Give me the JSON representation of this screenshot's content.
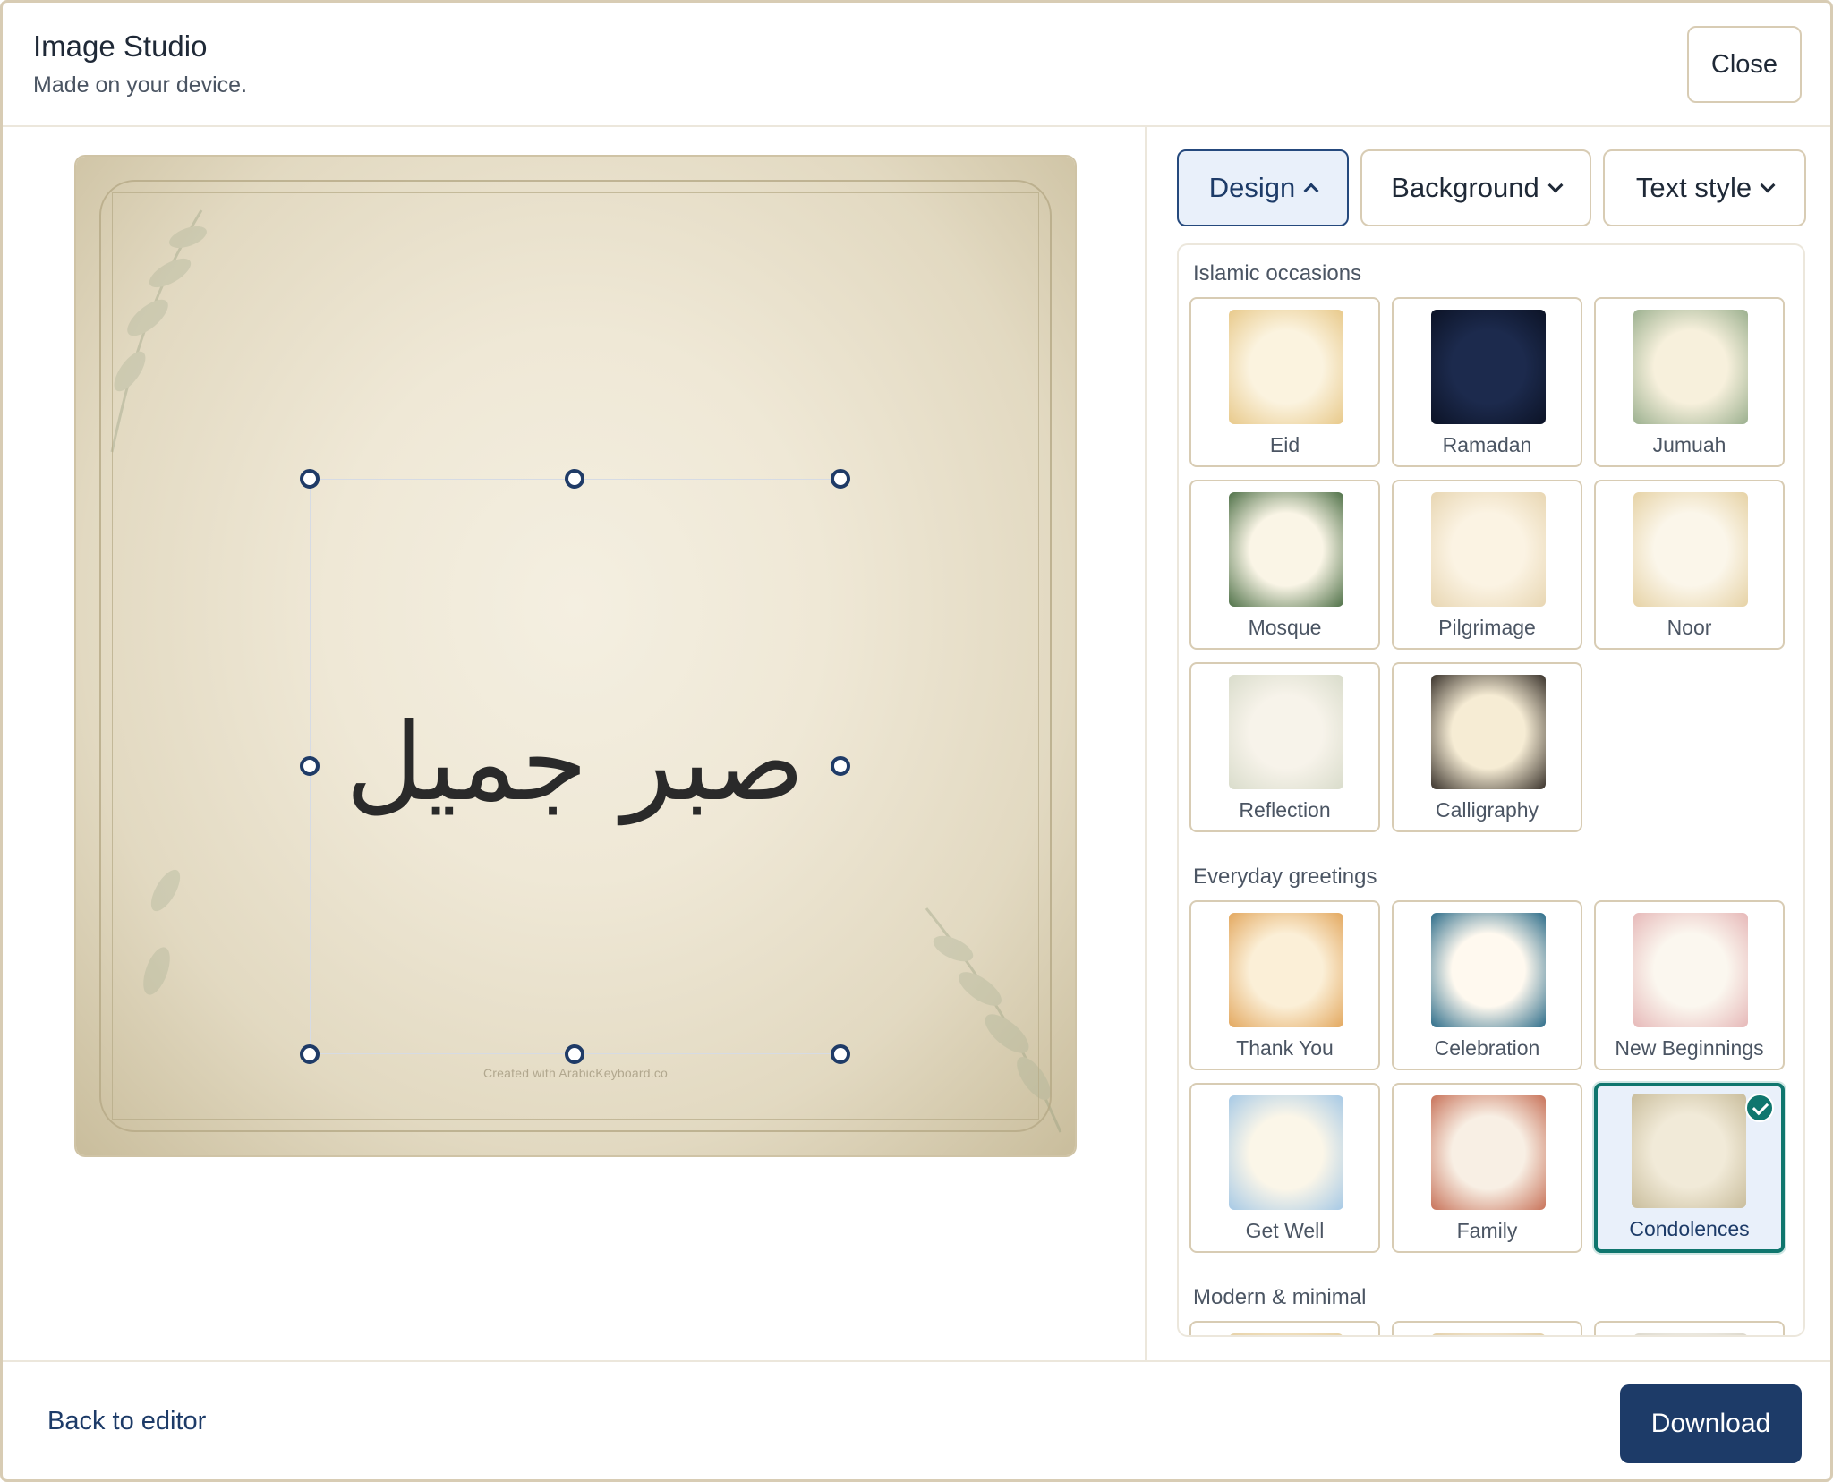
{
  "header": {
    "title": "Image Studio",
    "subtitle": "Made on your device.",
    "close_label": "Close"
  },
  "canvas": {
    "text": "صبر جميل",
    "watermark": "Created with ArabicKeyboard.co"
  },
  "tabs": [
    {
      "label": "Design",
      "active": true
    },
    {
      "label": "Background",
      "active": false
    },
    {
      "label": "Text style",
      "active": false
    }
  ],
  "sections": [
    {
      "title": "Islamic occasions",
      "items": [
        {
          "label": "Eid",
          "colors": [
            "#fbf3df",
            "#e8c98a"
          ]
        },
        {
          "label": "Ramadan",
          "colors": [
            "#1c2a4d",
            "#0c1326"
          ]
        },
        {
          "label": "Jumuah",
          "colors": [
            "#f7f0dc",
            "#9bb08f"
          ]
        },
        {
          "label": "Mosque",
          "colors": [
            "#faf5e6",
            "#4f7148"
          ]
        },
        {
          "label": "Pilgrimage",
          "colors": [
            "#fbf3e3",
            "#e8d6b2"
          ]
        },
        {
          "label": "Noor",
          "colors": [
            "#fbf6ea",
            "#e6d2a5"
          ]
        },
        {
          "label": "Reflection",
          "colors": [
            "#f7f3ea",
            "#d9dccb"
          ]
        },
        {
          "label": "Calligraphy",
          "colors": [
            "#f6ecd4",
            "#3a332c"
          ]
        }
      ]
    },
    {
      "title": "Everyday greetings",
      "items": [
        {
          "label": "Thank You",
          "colors": [
            "#fbefd7",
            "#e3a85f"
          ]
        },
        {
          "label": "Celebration",
          "colors": [
            "#fff9ef",
            "#2d6d8a"
          ]
        },
        {
          "label": "New Beginnings",
          "colors": [
            "#fbf7ef",
            "#e6b8b8"
          ]
        },
        {
          "label": "Get Well",
          "colors": [
            "#fbf6e8",
            "#a6c9e6"
          ]
        },
        {
          "label": "Family",
          "colors": [
            "#f8efe4",
            "#c8735a"
          ]
        },
        {
          "label": "Condolences",
          "colors": [
            "#f1ead8",
            "#c9bd9c"
          ],
          "selected": true
        }
      ]
    },
    {
      "title": "Modern & minimal",
      "items": [
        {
          "label": "",
          "colors": [
            "#f5e6c8",
            "#e7d2a8"
          ]
        },
        {
          "label": "",
          "colors": [
            "#f6ecdb",
            "#e3cfa8"
          ]
        },
        {
          "label": "",
          "colors": [
            "#f6f3ec",
            "#dcd8cc"
          ]
        }
      ]
    }
  ],
  "footer": {
    "back_label": "Back to editor",
    "download_label": "Download"
  },
  "colors": {
    "primary": "#1d3b68",
    "selected_border": "#0f766e",
    "tile_border": "#d8ccb4"
  }
}
